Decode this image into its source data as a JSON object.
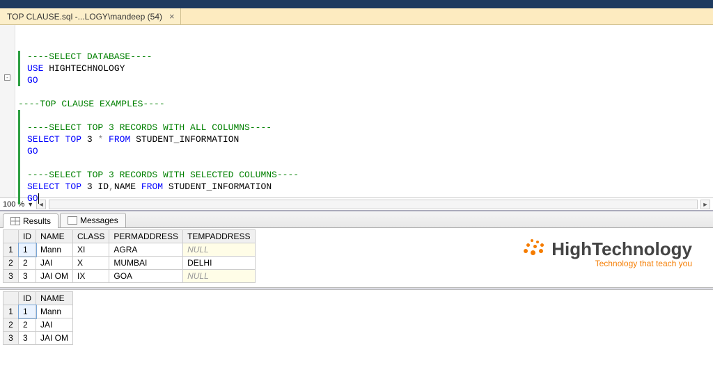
{
  "tab": {
    "label": "TOP CLAUSE.sql -...LOGY\\mandeep (54)",
    "close": "×"
  },
  "code": {
    "c1": "----SELECT DATABASE----",
    "l2a": "USE",
    "l2b": " HIGHTECHNOLOGY",
    "l3": "GO",
    "c5": "----TOP CLAUSE EXAMPLES----",
    "c7": "----SELECT TOP 3 RECORDS WITH ALL COLUMNS----",
    "l8a": "SELECT",
    "l8b": " TOP",
    "l8c": " 3 ",
    "l8d": "*",
    "l8e": " FROM",
    "l8f": " STUDENT_INFORMATION",
    "l9": "GO",
    "c11": "----SELECT TOP 3 RECORDS WITH SELECTED COLUMNS----",
    "l12a": "SELECT",
    "l12b": " TOP",
    "l12c": " 3 ID",
    "l12d": ",",
    "l12e": "NAME ",
    "l12f": "FROM",
    "l12g": " STUDENT_INFORMATION",
    "l13": "GO"
  },
  "zoom": {
    "value": "100 %"
  },
  "resultTabs": {
    "results": "Results",
    "messages": "Messages"
  },
  "grid1": {
    "headers": [
      "ID",
      "NAME",
      "CLASS",
      "PERMADDRESS",
      "TEMPADDRESS"
    ],
    "rows": [
      {
        "n": "1",
        "id": "1",
        "name": "Mann",
        "class": "XI",
        "perm": "AGRA",
        "temp": "NULL",
        "tempNull": true
      },
      {
        "n": "2",
        "id": "2",
        "name": "JAI",
        "class": "X",
        "perm": "MUMBAI",
        "temp": "DELHI",
        "tempNull": false
      },
      {
        "n": "3",
        "id": "3",
        "name": "JAI OM",
        "class": "IX",
        "perm": "GOA",
        "temp": "NULL",
        "tempNull": true
      }
    ]
  },
  "grid2": {
    "headers": [
      "ID",
      "NAME"
    ],
    "rows": [
      {
        "n": "1",
        "id": "1",
        "name": "Mann"
      },
      {
        "n": "2",
        "id": "2",
        "name": "JAI"
      },
      {
        "n": "3",
        "id": "3",
        "name": "JAI OM"
      }
    ]
  },
  "logo": {
    "text": "HighTechnology",
    "tagline": "Technology that teach you"
  }
}
